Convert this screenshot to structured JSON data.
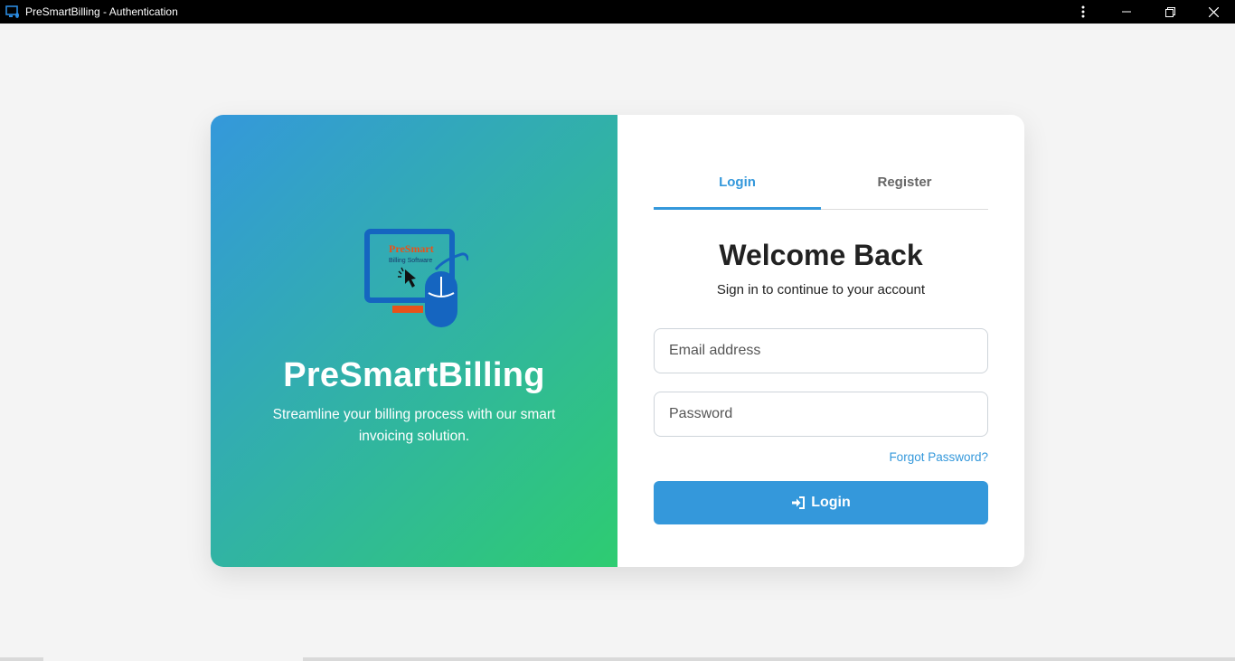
{
  "window": {
    "title": "PreSmartBilling - Authentication",
    "controls": [
      "menu-icon",
      "minimize-icon",
      "restore-icon",
      "close-icon"
    ]
  },
  "brand": {
    "logo_text": "PreSmart",
    "logo_subtext": "Billing Software",
    "name": "PreSmartBilling",
    "tagline": "Streamline your billing process with our smart invoicing solution."
  },
  "auth": {
    "tabs": [
      {
        "label": "Login",
        "active": true
      },
      {
        "label": "Register",
        "active": false
      }
    ],
    "heading": "Welcome Back",
    "subheading": "Sign in to continue to your account",
    "email_placeholder": "Email address",
    "password_placeholder": "Password",
    "forgot_label": "Forgot Password?",
    "login_label": "Login",
    "login_icon": "sign-in-icon"
  },
  "colors": {
    "accent": "#3498db",
    "gradient_start": "#3498db",
    "gradient_end": "#2ecc71",
    "logo_orange": "#e8521a",
    "logo_blue": "#1565c0"
  }
}
